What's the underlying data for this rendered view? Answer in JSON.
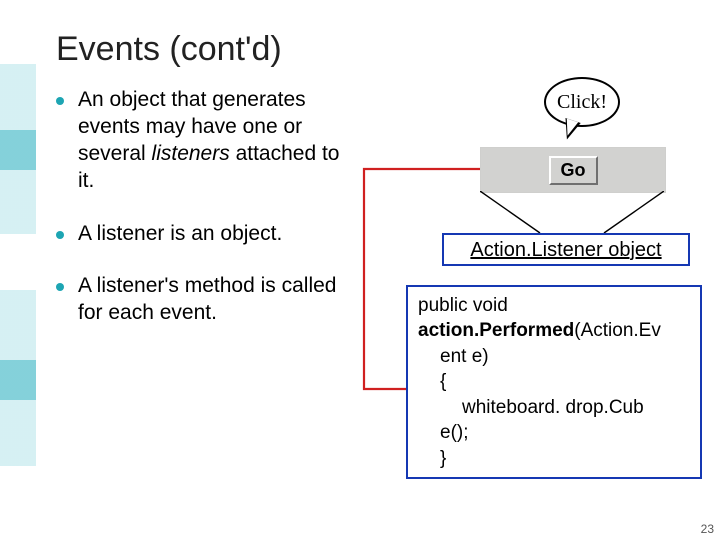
{
  "title": "Events (cont'd)",
  "bullets": {
    "b1_pre": "An object that generates events may have one or several ",
    "b1_em": "listeners",
    "b1_post": " attached to it.",
    "b2": "A listener is an object.",
    "b3": "A listener's method is called for each event."
  },
  "click_label": "Click!",
  "go_label": "Go",
  "listener_label": "Action.Listener object",
  "code": {
    "l1a": "public void ",
    "l1b": "action.Performed",
    "l1c": "(Action.Ev",
    "l2": "ent e)",
    "l3": "{",
    "l4": "whiteboard. drop.Cub",
    "l5": "e();",
    "l6": "}"
  },
  "page_number": "23"
}
